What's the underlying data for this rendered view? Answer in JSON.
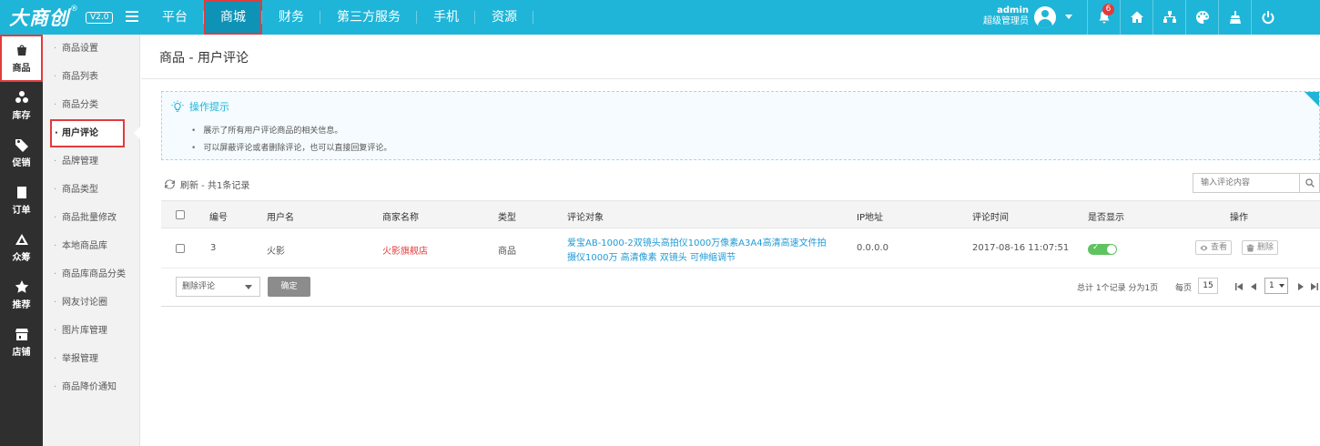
{
  "app": {
    "logo": "大商创",
    "reg": "®",
    "version": "V2.0"
  },
  "nav": [
    {
      "label": "平台"
    },
    {
      "label": "商城"
    },
    {
      "label": "财务"
    },
    {
      "label": "第三方服务"
    },
    {
      "label": "手机"
    },
    {
      "label": "资源"
    }
  ],
  "user": {
    "name": "admin",
    "role": "超级管理员"
  },
  "notifications": {
    "count": "6"
  },
  "top_icons": [
    "bell-icon",
    "home-icon",
    "sitemap-icon",
    "palette-icon",
    "clean-icon",
    "power-icon"
  ],
  "sidebar": [
    {
      "label": "商品",
      "icon": "goods-icon"
    },
    {
      "label": "库存",
      "icon": "stock-icon"
    },
    {
      "label": "促销",
      "icon": "promo-icon"
    },
    {
      "label": "订单",
      "icon": "order-icon"
    },
    {
      "label": "众筹",
      "icon": "crowdfund-icon"
    },
    {
      "label": "推荐",
      "icon": "star-icon"
    },
    {
      "label": "店铺",
      "icon": "shop-icon"
    }
  ],
  "submenu": [
    {
      "label": "商品设置"
    },
    {
      "label": "商品列表"
    },
    {
      "label": "商品分类"
    },
    {
      "label": "用户评论"
    },
    {
      "label": "品牌管理"
    },
    {
      "label": "商品类型"
    },
    {
      "label": "商品批量修改"
    },
    {
      "label": "本地商品库"
    },
    {
      "label": "商品库商品分类"
    },
    {
      "label": "网友讨论圈"
    },
    {
      "label": "图片库管理"
    },
    {
      "label": "举报管理"
    },
    {
      "label": "商品降价通知"
    }
  ],
  "page": {
    "title": "商品 - 用户评论"
  },
  "tips": {
    "title": "操作提示",
    "items": [
      "展示了所有用户评论商品的相关信息。",
      "可以屏蔽评论或者删除评论，也可以直接回复评论。"
    ]
  },
  "toolbar": {
    "refresh": "刷新 - 共1条记录",
    "search_placeholder": "输入评论内容"
  },
  "table": {
    "headers": {
      "id": "编号",
      "user": "用户名",
      "shop": "商家名称",
      "type": "类型",
      "target": "评论对象",
      "ip": "IP地址",
      "time": "评论时间",
      "show": "是否显示",
      "ops": "操作"
    },
    "rows": [
      {
        "id": "3",
        "user": "火影",
        "shop": "火影旗舰店",
        "type": "商品",
        "target": "爱宝AB-1000-2双镜头高拍仪1000万像素A3A4高清高速文件拍摄仪1000万 高清像素 双镜头 可伸缩调节",
        "ip": "0.0.0.0",
        "time": "2017-08-16 11:07:51",
        "view": "查看",
        "delete": "删除"
      }
    ]
  },
  "footer": {
    "bulk_action": "删除评论",
    "confirm": "确定",
    "summary": "总计 1个记录 分为1页",
    "per_page_label": "每页",
    "per_page": "15",
    "current_page": "1"
  }
}
